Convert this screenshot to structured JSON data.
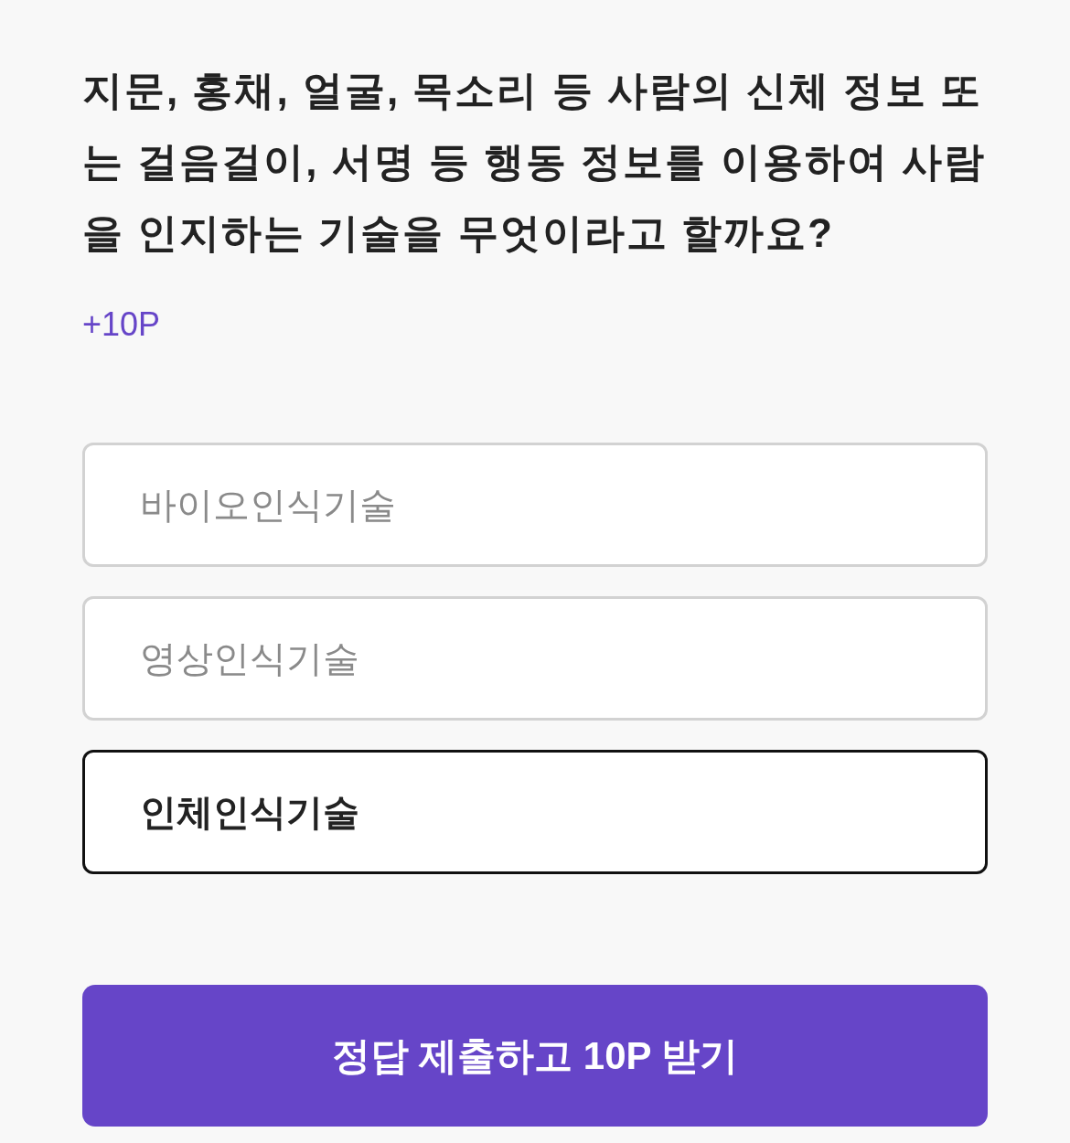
{
  "question": "지문, 홍채, 얼굴, 목소리 등 사람의 신체 정보 또는 걸음걸이, 서명 등 행동 정보를 이용하여 사람을 인지하는 기술을 무엇이라고 할까요?",
  "points": "+10P",
  "options": [
    {
      "label": "바이오인식기술",
      "selected": false
    },
    {
      "label": "영상인식기술",
      "selected": false
    },
    {
      "label": "인체인식기술",
      "selected": true
    }
  ],
  "submit_button": "정답 제출하고 10P 받기"
}
